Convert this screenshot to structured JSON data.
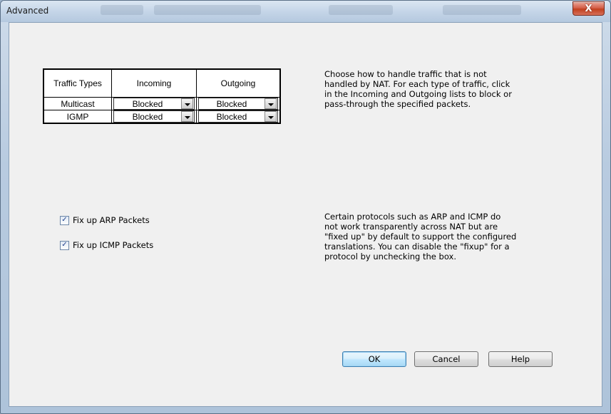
{
  "window": {
    "title": "Advanced",
    "close_glyph": "X"
  },
  "traffic_table": {
    "headers": [
      "Traffic Types",
      "Incoming",
      "Outgoing"
    ],
    "rows": [
      {
        "type": "Multicast",
        "incoming": "Blocked",
        "outgoing": "Blocked"
      },
      {
        "type": "IGMP",
        "incoming": "Blocked",
        "outgoing": "Blocked"
      }
    ]
  },
  "traffic_description": "Choose how to handle traffic that is not\nhandled by NAT. For each type of traffic, click\nin the Incoming and Outgoing lists to block or\npass-through the specified packets.",
  "checkboxes": [
    {
      "label": "Fix up ARP Packets",
      "checked": true
    },
    {
      "label": "Fix up ICMP Packets",
      "checked": true
    }
  ],
  "fixup_description": "Certain protocols such as ARP and ICMP do\nnot work transparently across NAT but are\n\"fixed up\" by default to support the configured\ntranslations. You can disable the \"fixup\" for a\nprotocol by unchecking the box.",
  "buttons": {
    "ok": "OK",
    "cancel": "Cancel",
    "help": "Help"
  },
  "colors": {
    "accent": "#3c7fb1",
    "close": "#c2401f",
    "checkmark": "#1f3f8c"
  },
  "icons": {
    "close": "close-icon",
    "dropdown": "chevron-down-icon",
    "check": "checkmark-icon"
  }
}
